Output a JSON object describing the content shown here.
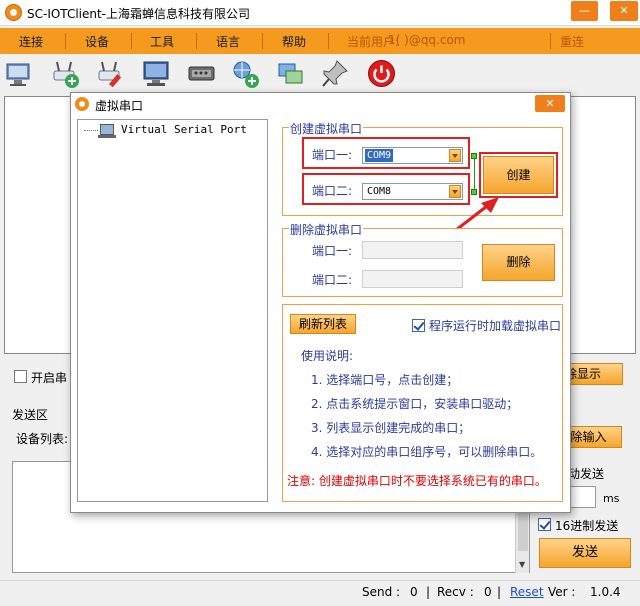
{
  "app": {
    "title": "SC-IOTClient-上海霜蝉信息科技有限公司",
    "window_min": "—",
    "window_max": "□",
    "window_close": "✕"
  },
  "menu": {
    "items": [
      "连接",
      "设备",
      "工具",
      "语言",
      "帮助"
    ],
    "current_user_label": "当前用户:",
    "current_user_value": "1(               )@qq.com",
    "relogin": "重连"
  },
  "main": {
    "open_port_label": "开启串",
    "send_title": "发送区",
    "device_list_label": "设备列表:",
    "clear_display_btn": "除显示",
    "clear_input_btn": "除输入",
    "auto_send_label": "动发送",
    "ms_label": "ms",
    "hex_send_label": "16进制发送",
    "send_btn": "发送"
  },
  "status": {
    "send_label": "Send :",
    "send_value": "0",
    "recv_label": "Recv :",
    "recv_value": "0",
    "reset": "Reset",
    "ver_label": "Ver :",
    "ver_value": "1.0.4"
  },
  "dialog": {
    "title": "虚拟串口",
    "close": "✕",
    "tree_item": "Virtual Serial Port",
    "create_group": {
      "legend": "创建虚拟串口",
      "port1_label": "端口一:",
      "port1_value": "COM9",
      "port2_label": "端口二:",
      "port2_value": "COM8",
      "create_btn": "创建"
    },
    "delete_group": {
      "legend": "删除虚拟串口",
      "port1_label": "端口一:",
      "port2_label": "端口二:",
      "delete_btn": "删除"
    },
    "options": {
      "refresh_btn": "刷新列表",
      "load_on_start_label": "程序运行时加载虚拟串口",
      "load_on_start_checked": true,
      "usage_title": "使用说明:",
      "usage_steps": [
        "1. 选择端口号，点击创建；",
        "2. 点击系统提示窗口，安装串口驱动；",
        "3. 列表显示创建完成的串口；",
        "4. 选择对应的串口组序号，可以删除串口。"
      ],
      "warning": "注意: 创建虚拟串口时不要选择系统已有的串口。"
    }
  }
}
